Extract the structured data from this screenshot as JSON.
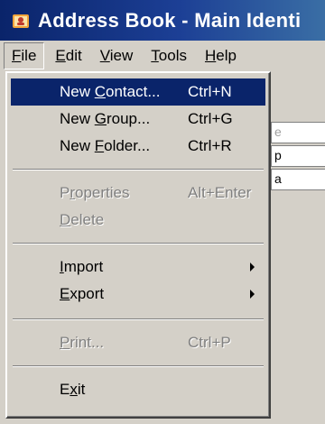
{
  "title_bar": {
    "title": "Address Book - Main Identi",
    "icon": "address-book-icon"
  },
  "menu_bar": {
    "items": [
      {
        "pre": "",
        "mn": "F",
        "post": "ile"
      },
      {
        "pre": "",
        "mn": "E",
        "post": "dit"
      },
      {
        "pre": "",
        "mn": "V",
        "post": "iew"
      },
      {
        "pre": "",
        "mn": "T",
        "post": "ools"
      },
      {
        "pre": "",
        "mn": "H",
        "post": "elp"
      }
    ]
  },
  "file_menu": {
    "items": [
      {
        "pre": "New ",
        "mn": "C",
        "post": "ontact...",
        "shortcut": "Ctrl+N"
      },
      {
        "pre": "New ",
        "mn": "G",
        "post": "roup...",
        "shortcut": "Ctrl+G"
      },
      {
        "pre": "New ",
        "mn": "F",
        "post": "older...",
        "shortcut": "Ctrl+R"
      },
      {
        "pre": "P",
        "mn": "r",
        "post": "operties",
        "shortcut": "Alt+Enter"
      },
      {
        "pre": "",
        "mn": "D",
        "post": "elete",
        "shortcut": ""
      },
      {
        "pre": "",
        "mn": "I",
        "post": "mport",
        "shortcut": ""
      },
      {
        "pre": "",
        "mn": "E",
        "post": "xport",
        "shortcut": ""
      },
      {
        "pre": "",
        "mn": "P",
        "post": "rint...",
        "shortcut": "Ctrl+P"
      },
      {
        "pre": "E",
        "mn": "x",
        "post": "it",
        "shortcut": ""
      }
    ]
  },
  "background_window": {
    "letters": [
      "e",
      "p",
      "a"
    ]
  },
  "colors": {
    "highlight": "#0a246a",
    "menu_bg": "#d4d0c8",
    "disabled_text": "#808080"
  }
}
